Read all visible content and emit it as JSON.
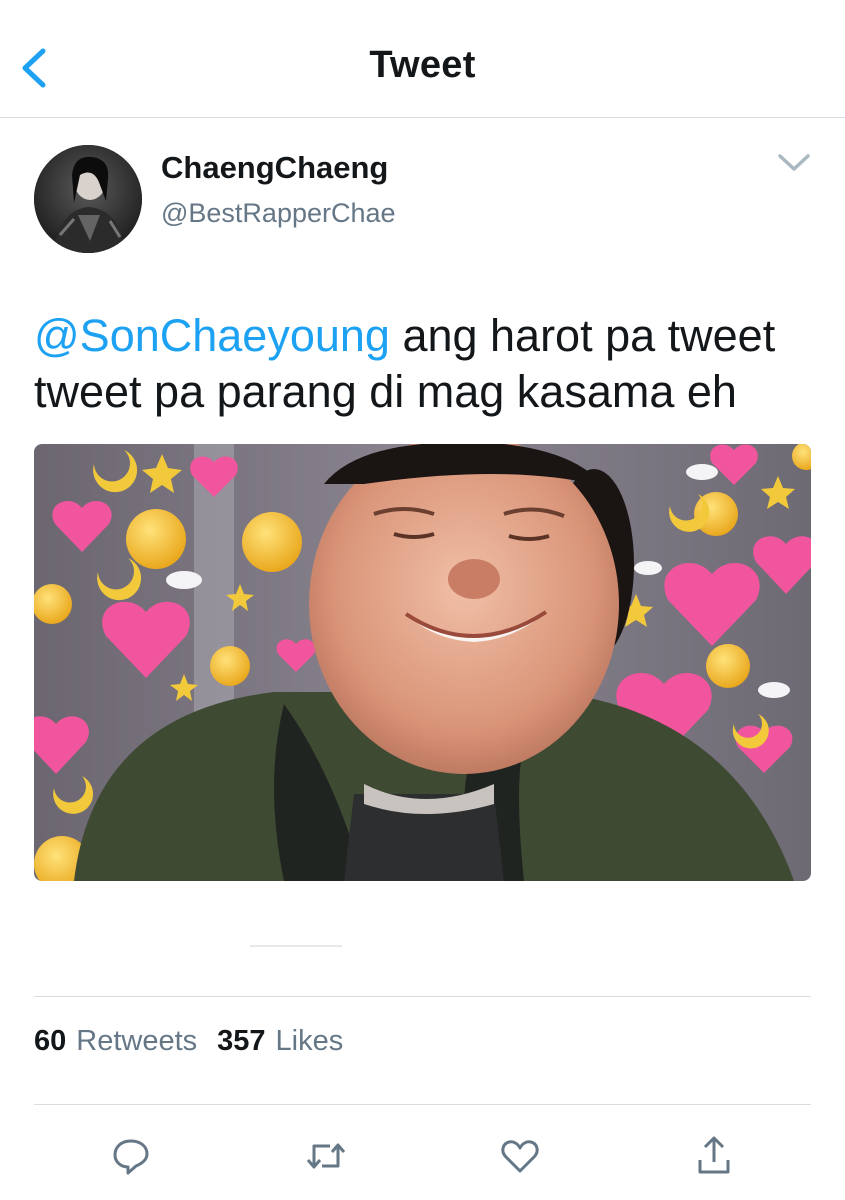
{
  "header": {
    "title": "Tweet",
    "back_icon": "chevron-left-icon"
  },
  "tweet": {
    "author_name": "ChaengChaeng",
    "author_handle": "@BestRapperChae",
    "mention": "@SonChaeyoung",
    "body": " ang harot pa tweet tweet pa parang di mag kasama eh",
    "media_alt": "photo of a smiling person in front of a background of heart and emoji stickers"
  },
  "stats": {
    "retweets_count": "60",
    "retweets_label": "Retweets",
    "likes_count": "357",
    "likes_label": "Likes"
  },
  "actions": {
    "reply_icon": "reply-icon",
    "retweet_icon": "retweet-icon",
    "like_icon": "heart-icon",
    "share_icon": "share-icon"
  },
  "colors": {
    "accent": "#1da1f2",
    "secondary_text": "#657786",
    "divider": "#d8dde1"
  }
}
